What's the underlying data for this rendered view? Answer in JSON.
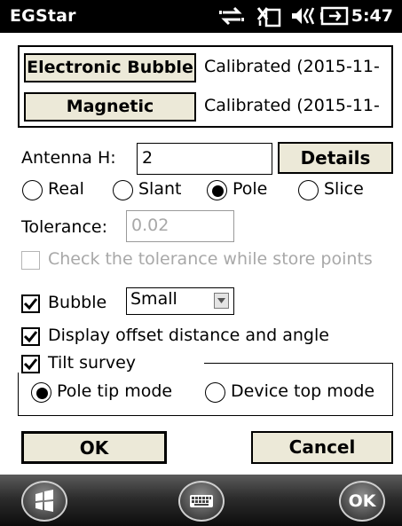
{
  "status_bar": {
    "app_title": "EGStar",
    "clock": "5:47",
    "icons": [
      "network-sync-icon",
      "signal-icon",
      "volume-icon",
      "battery-icon"
    ]
  },
  "calibration": {
    "electronic_bubble_label": "Electronic Bubble",
    "electronic_bubble_status": "Calibrated (2015-11-",
    "magnetic_label": "Magnetic",
    "magnetic_status": "Calibrated (2015-11-"
  },
  "antenna": {
    "label": "Antenna H:",
    "value": "2",
    "details_label": "Details",
    "types": [
      {
        "label": "Real",
        "selected": false
      },
      {
        "label": "Slant",
        "selected": false
      },
      {
        "label": "Pole",
        "selected": true
      },
      {
        "label": "Slice",
        "selected": false
      }
    ]
  },
  "tolerance": {
    "label": "Tolerance:",
    "value": "0.02",
    "check_label": "Check the tolerance while store points",
    "checked": false,
    "enabled": false
  },
  "bubble": {
    "label": "Bubble",
    "checked": true,
    "size_value": "Small"
  },
  "offset": {
    "label": "Display offset distance and angle",
    "checked": true
  },
  "tilt": {
    "label": "Tilt survey",
    "checked": true,
    "modes": [
      {
        "label": "Pole tip mode",
        "selected": true
      },
      {
        "label": "Device top mode",
        "selected": false
      }
    ]
  },
  "actions": {
    "ok_label": "OK",
    "cancel_label": "Cancel"
  },
  "softkeys": {
    "ok_label": "OK",
    "start_icon": "windows-start-icon",
    "keyboard_icon": "keyboard-icon"
  }
}
